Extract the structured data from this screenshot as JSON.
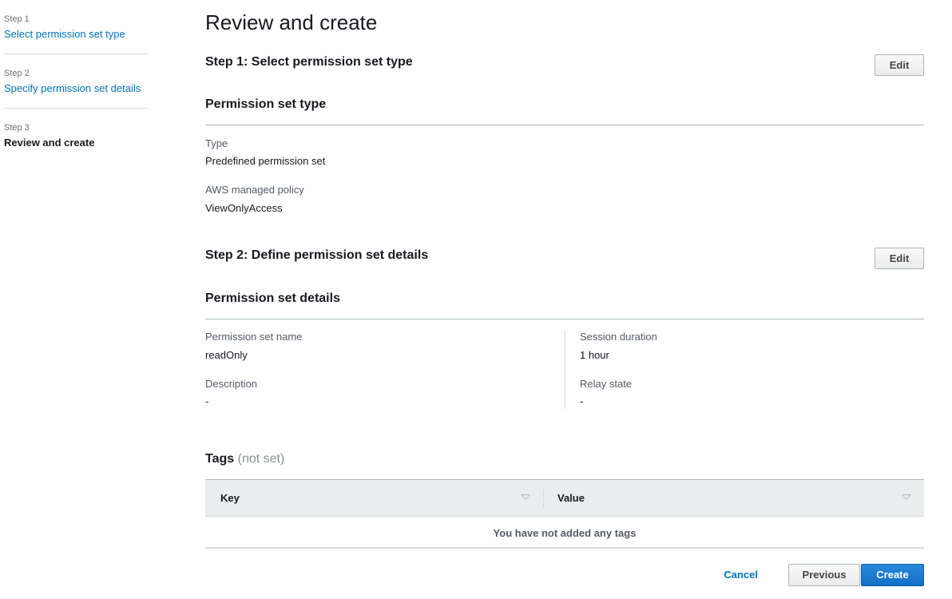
{
  "sidebar": {
    "steps": [
      {
        "number": "Step 1",
        "label": "Select permission set type"
      },
      {
        "number": "Step 2",
        "label": "Specify permission set details"
      },
      {
        "number": "Step 3",
        "label": "Review and create"
      }
    ]
  },
  "main": {
    "title": "Review and create",
    "step1": {
      "heading": "Step 1: Select permission set type",
      "edit_label": "Edit",
      "section_title": "Permission set type",
      "type_label": "Type",
      "type_value": "Predefined permission set",
      "policy_label": "AWS managed policy",
      "policy_value": "ViewOnlyAccess"
    },
    "step2": {
      "heading": "Step 2: Define permission set details",
      "edit_label": "Edit",
      "section_title": "Permission set details",
      "name_label": "Permission set name",
      "name_value": "readOnly",
      "description_label": "Description",
      "description_value": "-",
      "session_label": "Session duration",
      "session_value": "1 hour",
      "relay_label": "Relay state",
      "relay_value": "-"
    },
    "tags": {
      "title": "Tags",
      "status": "(not set)",
      "columns": [
        "Key",
        "Value"
      ],
      "empty_message": "You have not added any tags"
    }
  },
  "footer": {
    "cancel_label": "Cancel",
    "previous_label": "Previous",
    "create_label": "Create"
  },
  "colors": {
    "link": "#0073bb",
    "primary_button": "#1170c8",
    "text": "#16191f",
    "muted_text": "#545b64"
  }
}
